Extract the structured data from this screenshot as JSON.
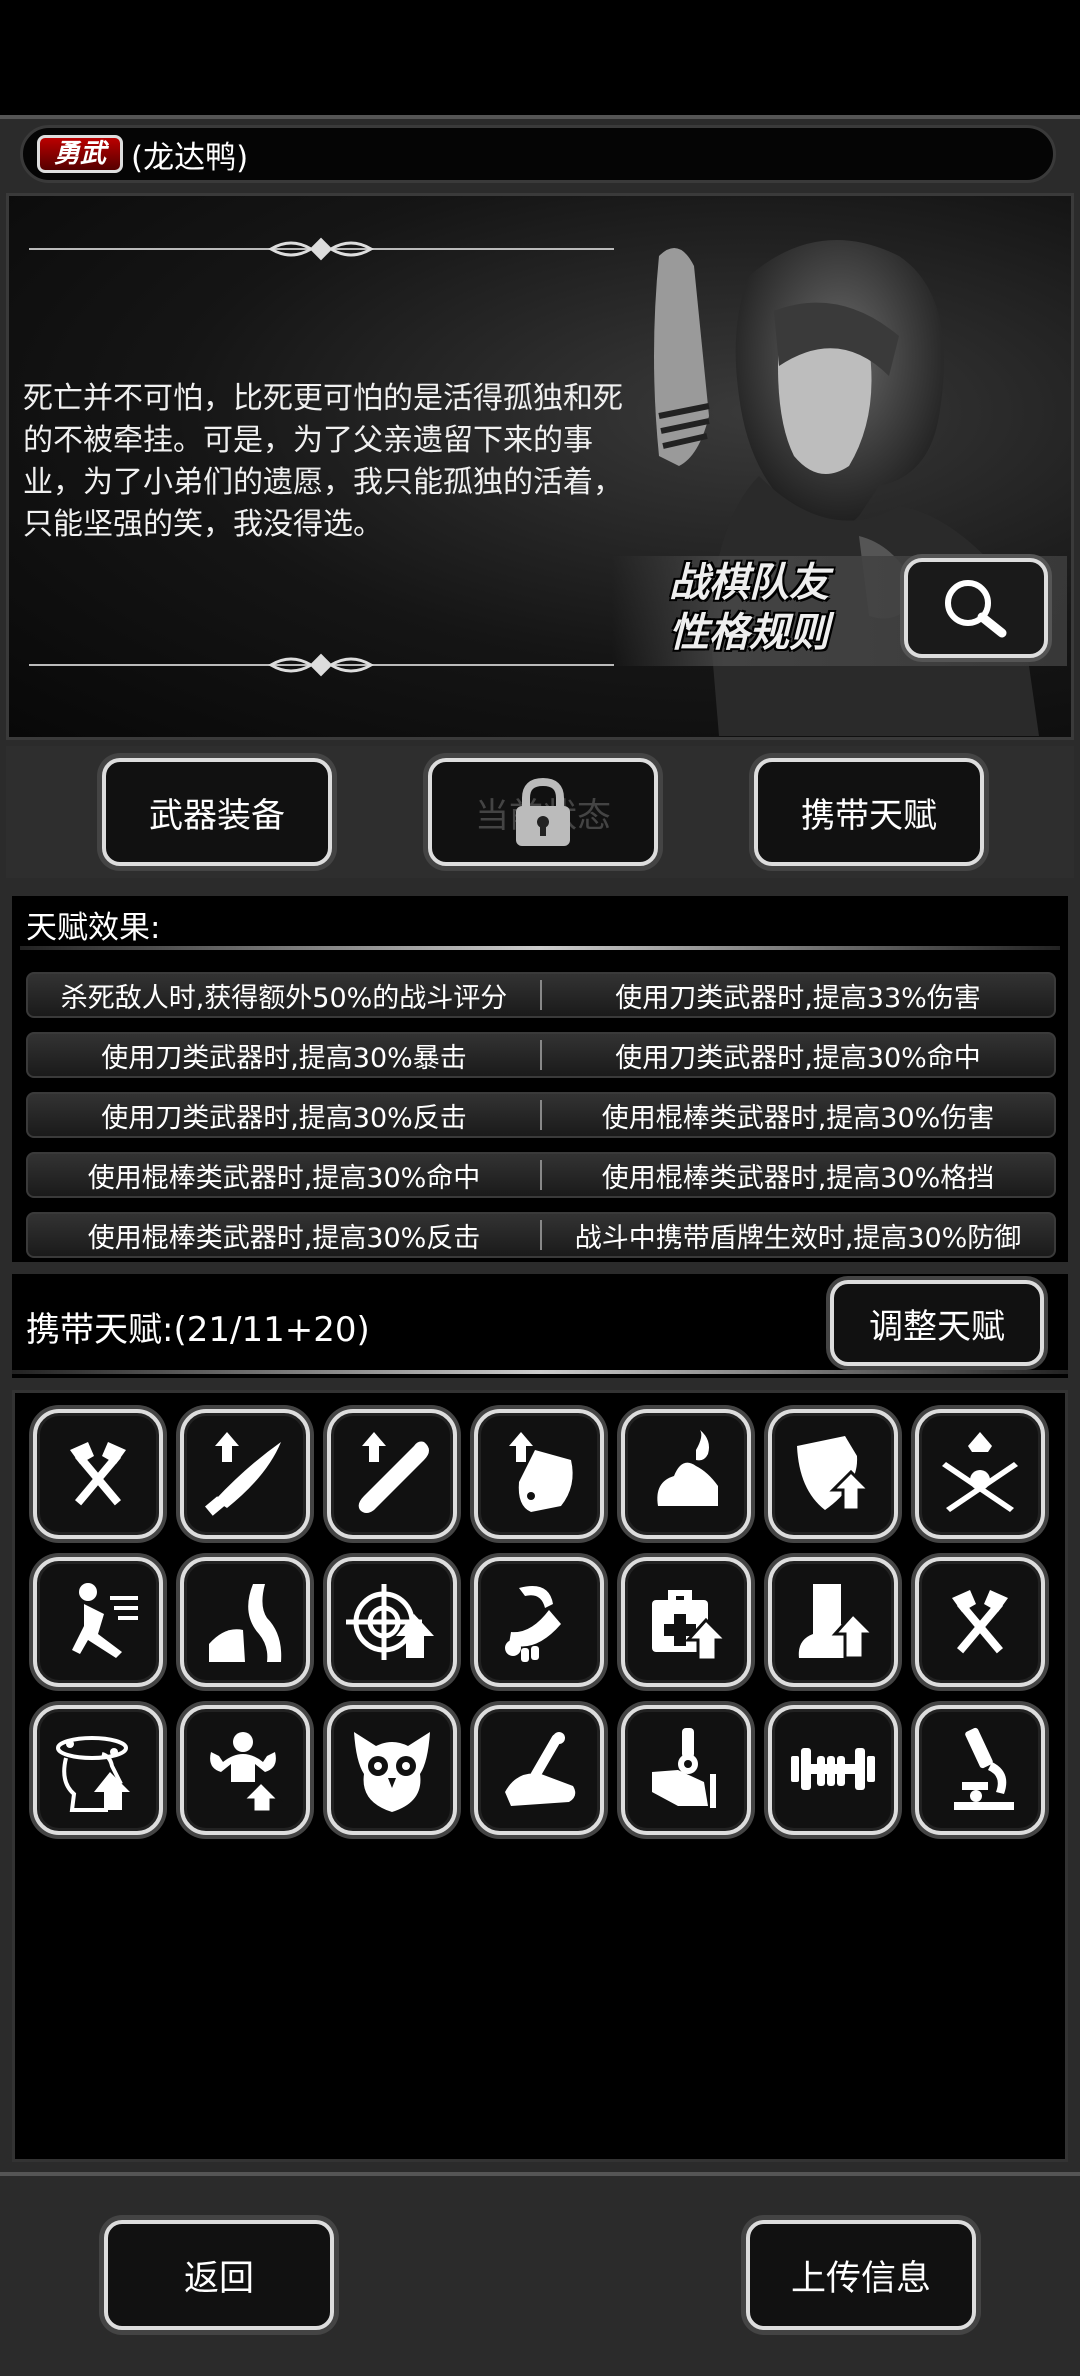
{
  "header": {
    "rank_badge": "勇武",
    "character_name": "(龙达鸭)"
  },
  "story": {
    "text": "死亡并不可怕，比死更可怕的是活得孤独和死的不被牵挂。可是，为了父亲遗留下来的事业，为了小弟们的遗愿，我只能孤独的活着，只能坚强的笑，我没得选。",
    "rules_line1": "战棋队友",
    "rules_line2": "性格规则"
  },
  "tabs": {
    "weapons": "武器装备",
    "current_status": "当前状态",
    "carry_talents": "携带天赋"
  },
  "effects": {
    "title": "天赋效果:",
    "rows": [
      [
        "杀死敌人时,获得额外50%的战斗评分",
        "使用刀类武器时,提高33%伤害"
      ],
      [
        "使用刀类武器时,提高30%暴击",
        "使用刀类武器时,提高30%命中"
      ],
      [
        "使用刀类武器时,提高30%反击",
        "使用棍棒类武器时,提高30%伤害"
      ],
      [
        "使用棍棒类武器时,提高30%命中",
        "使用棍棒类武器时,提高30%格挡"
      ],
      [
        "使用棍棒类武器时,提高30%反击",
        "战斗中携带盾牌生效时,提高30%防御"
      ]
    ]
  },
  "carry": {
    "label": "携带天赋:(21/11+20)",
    "adjust_button": "调整天赋"
  },
  "talent_icons": [
    "crossed-axes-icon",
    "blade-up-icon",
    "club-up-icon",
    "shield-up-icon",
    "muscle-fire-icon",
    "shield-badge-up-icon",
    "crossed-swords-crown-icon",
    "dash-icon",
    "road-icon",
    "target-up-icon",
    "arm-strike-icon",
    "medkit-up-icon",
    "boot-up-icon",
    "crossed-axes-icon",
    "dizzy-head-up-icon",
    "flex-up-icon",
    "owl-icon",
    "broken-arm-icon",
    "hand-drill-icon",
    "dumbbell-icon",
    "microscope-icon"
  ],
  "bottom": {
    "back_button": "返回",
    "upload_button": "上传信息"
  },
  "colors": {
    "badge_red": "#b00000",
    "panel_bg": "#2b2b2b",
    "button_border": "#dddddd"
  }
}
